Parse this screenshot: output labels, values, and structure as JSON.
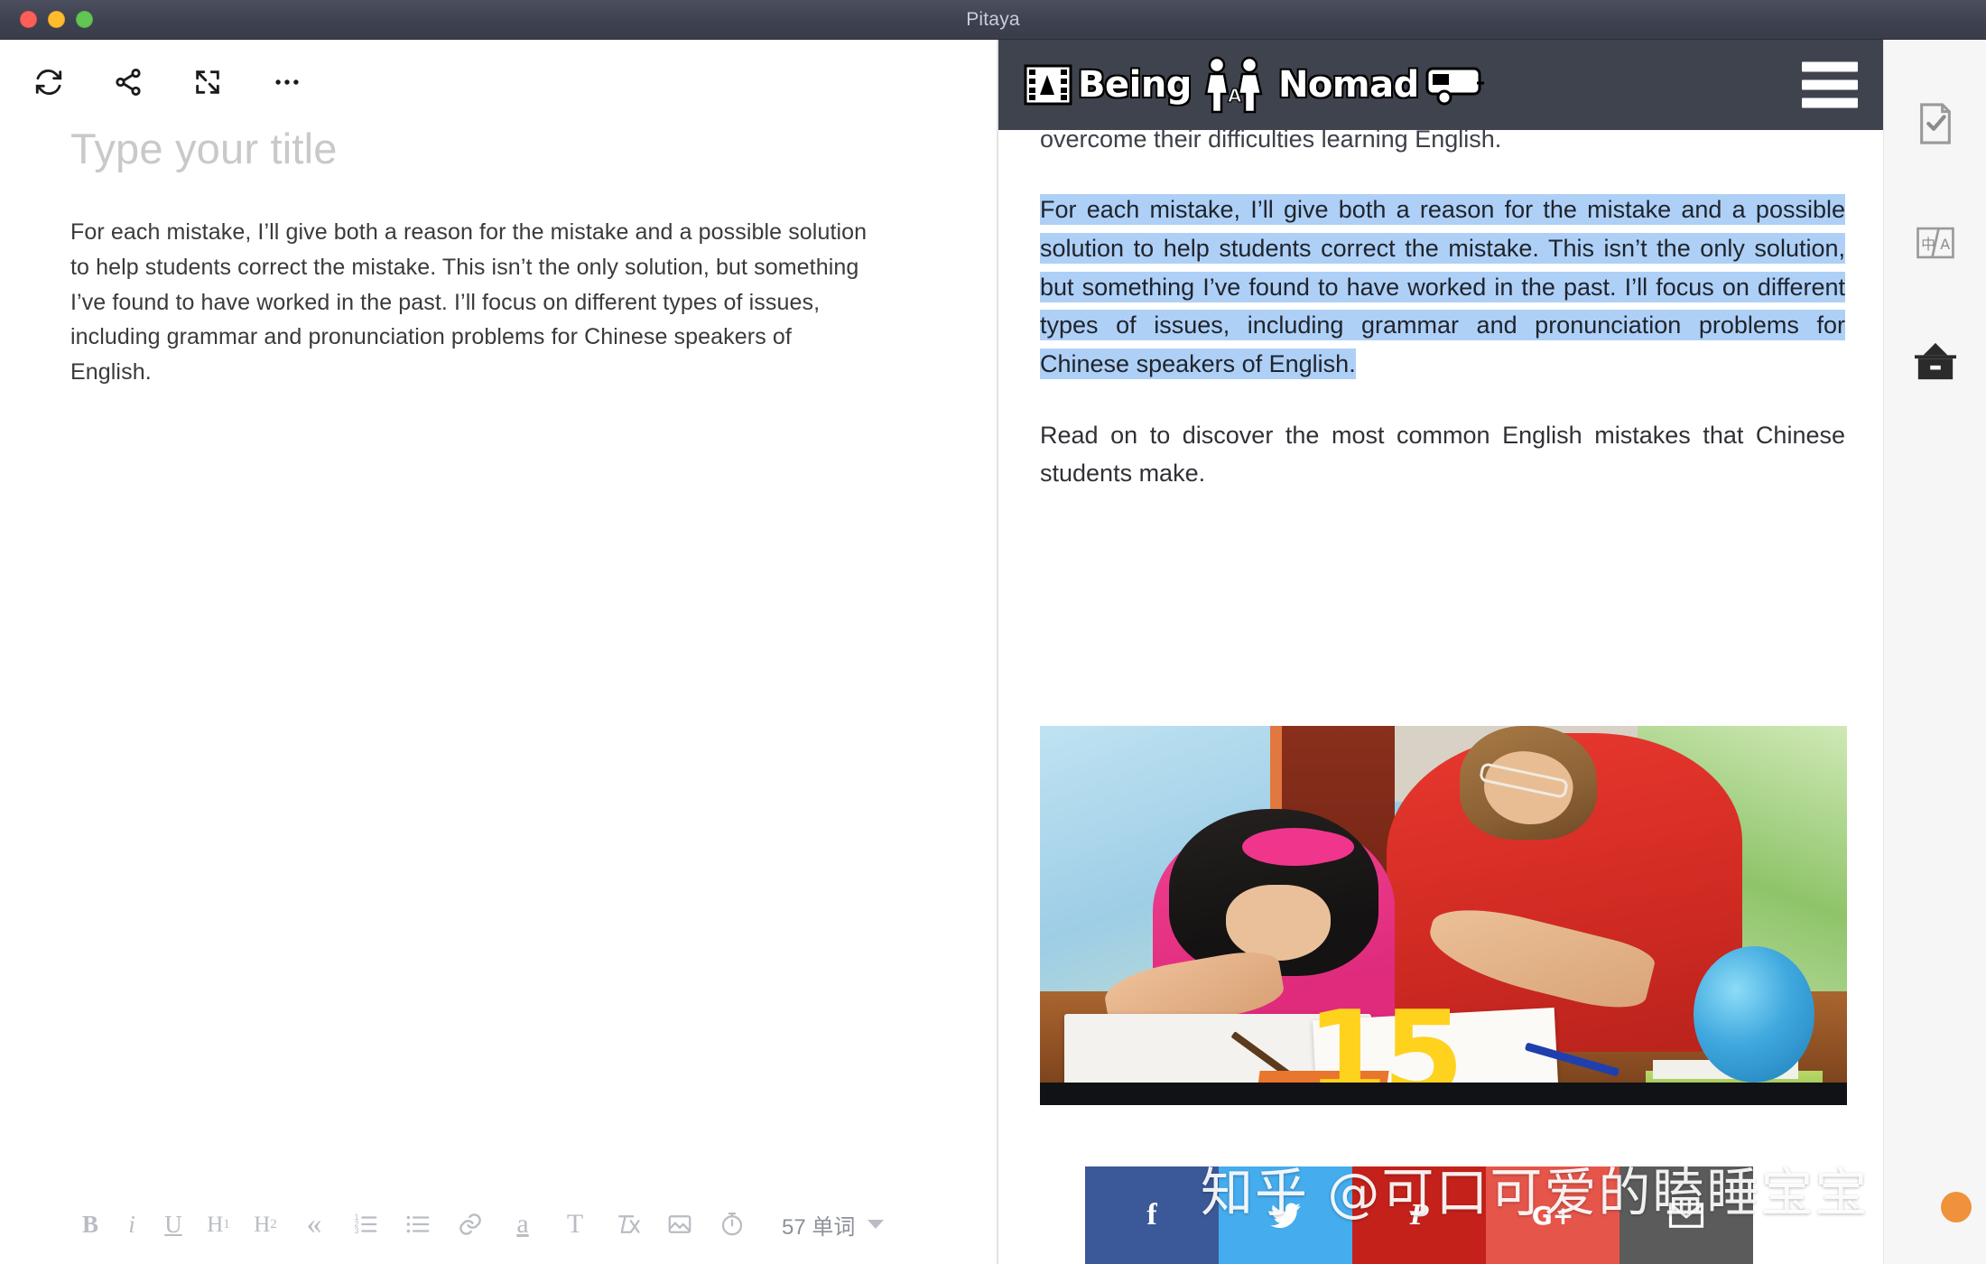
{
  "window": {
    "title": "Pitaya",
    "traffic_lights": [
      "close",
      "minimize",
      "zoom"
    ]
  },
  "editor": {
    "toolbar_icons": [
      "refresh-icon",
      "share-icon",
      "fullscreen-icon",
      "more-options-icon"
    ],
    "title_placeholder": "Type your title",
    "paragraph": "For each mistake, I’ll give both a reason for the mistake and a possible solution to help students correct the mistake. This isn’t the only solution, but something I’ve found to have worked in the past. I’ll focus on different types of issues, including grammar and pronunciation problems for Chinese speakers of English.",
    "format_bar": {
      "bold": "B",
      "italic": "i",
      "underline": "U",
      "heading1": "H",
      "heading1_sub": "1",
      "heading2": "H",
      "heading2_sub": "2",
      "quote": "«",
      "ordered_list": "ordered-list-icon",
      "bullet_list": "bullet-list-icon",
      "link": "link-icon",
      "highlight": "a",
      "text_style": "T",
      "clear_format": "clear-format-icon",
      "image": "image-icon",
      "timer": "timer-icon",
      "word_count": "57 单词"
    }
  },
  "preview": {
    "site_header": {
      "brand_part1": "Being",
      "brand_part2": "Nomad",
      "brand_connector": "A",
      "menu": "hamburger-menu-icon"
    },
    "paragraph_top": "… to Chinese students. But students can use it well to help them overcome their difficulties learning English.",
    "paragraph_selected": "For each mistake, I’ll give both a reason for the mistake and a possible solution to help students correct the mistake. This isn’t the only solution, but something I’ve found to have worked in the past. I’ll focus on different types of issues, including grammar and pronunciation problems for Chinese speakers of English.",
    "paragraph_after": "Read on to discover the most common English mistakes that Chinese students make.",
    "figure": {
      "alt": "teacher-helping-student-photo",
      "overlay_number": "15"
    },
    "share_buttons": [
      {
        "name": "facebook",
        "glyph": "f",
        "color": "#3b5998"
      },
      {
        "name": "twitter",
        "glyph": "ᵗ",
        "color": "#45acee"
      },
      {
        "name": "pinterest",
        "glyph": "P",
        "color": "#c4211b"
      },
      {
        "name": "googleplus",
        "glyph": "G+",
        "color": "#e5554a"
      },
      {
        "name": "email",
        "glyph": "✉",
        "color": "#5b5b5b"
      }
    ]
  },
  "watermark": {
    "text": "知乎 @可口可爱的瞌睡宝宝"
  },
  "right_rail": {
    "icons": [
      "document-check-icon",
      "translate-icon",
      "archive-icon"
    ]
  },
  "colors": {
    "titlebar": "#3e4250",
    "selection": "#aed0f7",
    "site_header": "#3f434e",
    "rail_bg": "#f6f6f6",
    "placeholder": "#c9c9c9"
  }
}
